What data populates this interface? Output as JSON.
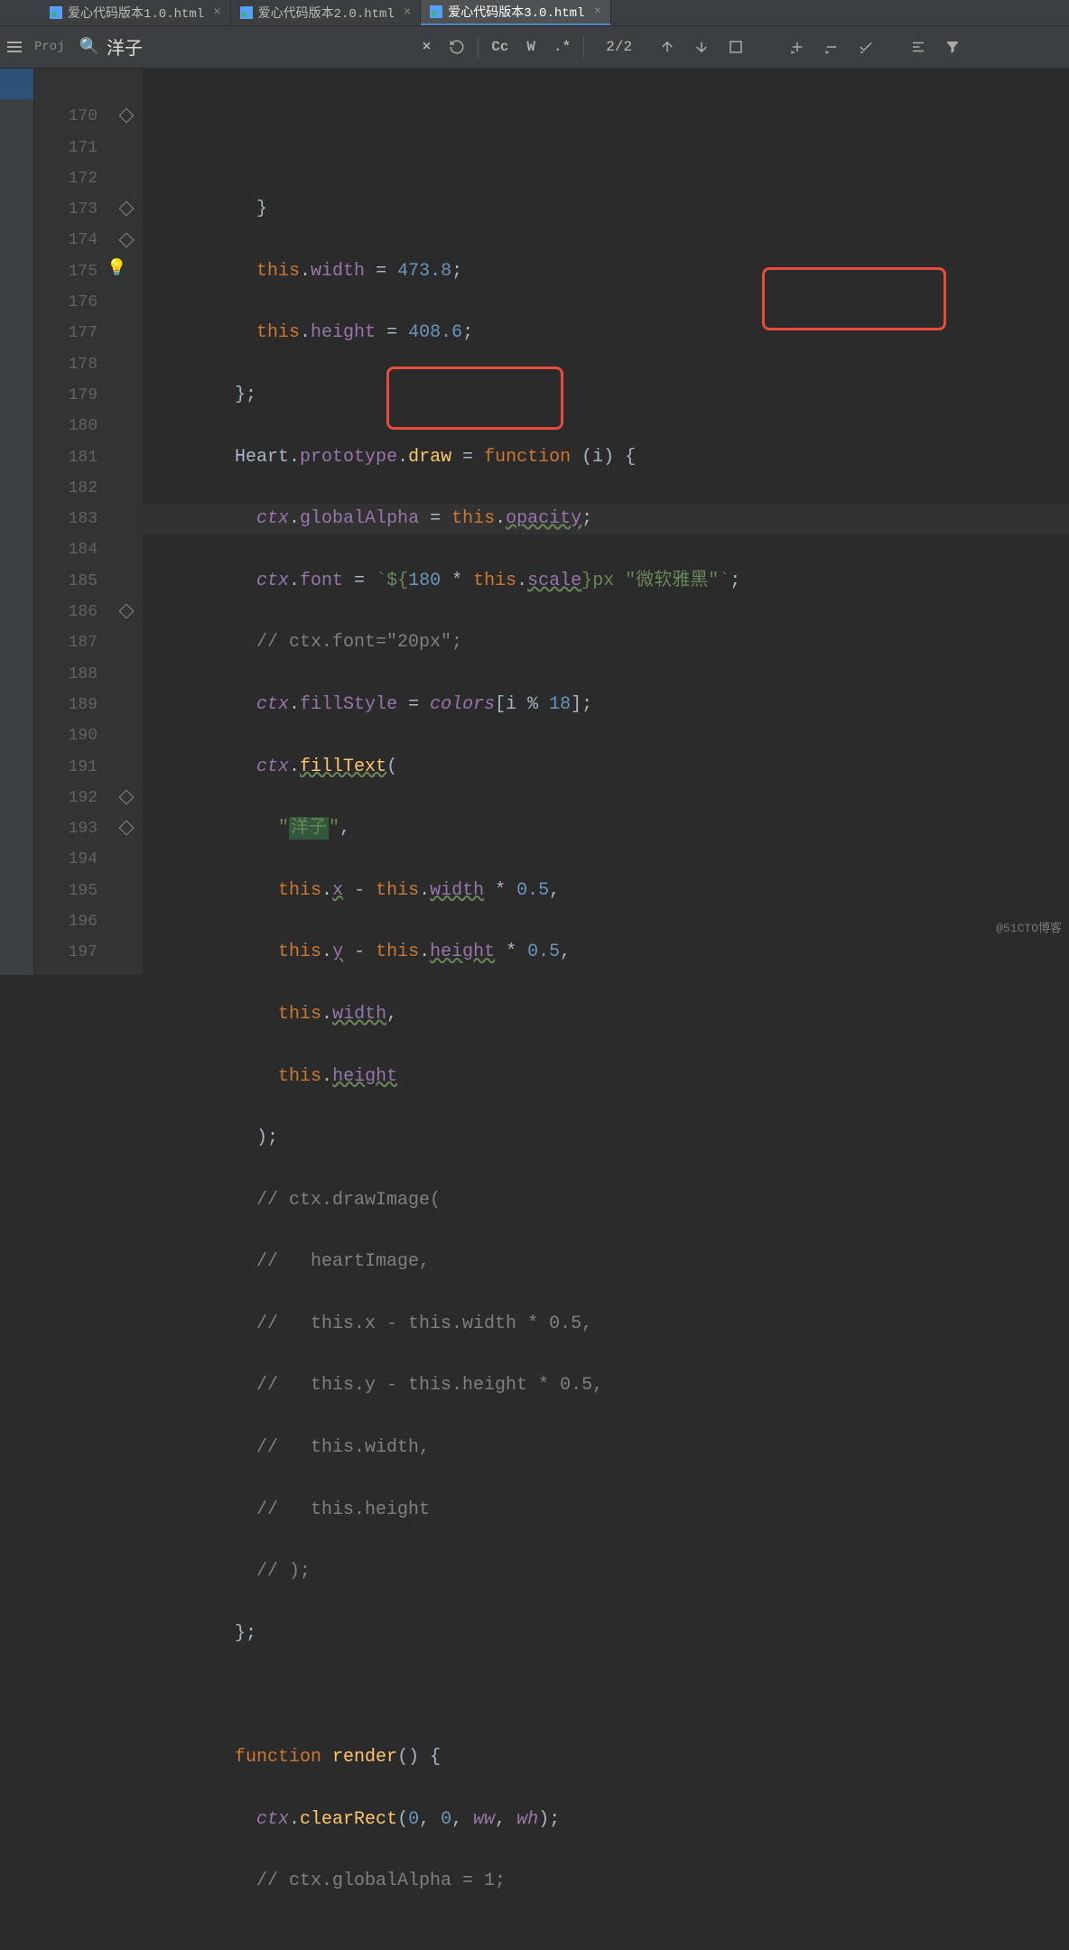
{
  "tabs": [
    {
      "label": "爱心代码版本1.0.html",
      "active": false
    },
    {
      "label": "爱心代码版本2.0.html",
      "active": false
    },
    {
      "label": "爱心代码版本3.0.html",
      "active": true
    }
  ],
  "project_label": "Proj",
  "search": {
    "query": "洋子",
    "close": "×",
    "counter": "2/2"
  },
  "toolbar": {
    "cc": "Cc",
    "w": "W",
    "dotstar": ".*"
  },
  "line_numbers": [
    "",
    "170",
    "171",
    "172",
    "173",
    "174",
    "175",
    "176",
    "177",
    "178",
    "179",
    "180",
    "181",
    "182",
    "183",
    "184",
    "185",
    "186",
    "187",
    "188",
    "189",
    "190",
    "191",
    "192",
    "193",
    "194",
    "195",
    "196",
    "197"
  ],
  "fold_positions": [
    1,
    4,
    5,
    17,
    23,
    24
  ],
  "code": {
    "l170": "        }",
    "l171_a": "        ",
    "l171_this": "this",
    "l171_b": ".",
    "l171_width": "width",
    "l171_c": " = ",
    "l171_num": "473.8",
    "l171_d": ";",
    "l172_a": "        ",
    "l172_this": "this",
    "l172_b": ".",
    "l172_height": "height",
    "l172_c": " = ",
    "l172_num": "408.6",
    "l172_d": ";",
    "l173": "      };",
    "l174_a": "      ",
    "l174_heart": "Heart",
    "l174_b": ".",
    "l174_proto": "prototype",
    "l174_c": ".",
    "l174_draw": "draw",
    "l174_d": " = ",
    "l174_fn": "function",
    "l174_e": " (",
    "l174_i": "i",
    "l174_f": ") {",
    "l175_a": "        ",
    "l175_ctx": "ctx",
    "l175_b": ".",
    "l175_ga": "globalAlpha",
    "l175_c": " = ",
    "l175_this": "this",
    "l175_d": ".",
    "l175_op": "opacity",
    "l175_e": ";",
    "l176_a": "        ",
    "l176_ctx": "ctx",
    "l176_b": ".",
    "l176_font": "font",
    "l176_c": " = ",
    "l176_s1": "`${",
    "l176_n": "180",
    "l176_s2": " * ",
    "l176_this": "this",
    "l176_d": ".",
    "l176_scale": "scale",
    "l176_s3": "}",
    "l176_s4": "px \"微软雅黑\"`",
    "l176_e": ";",
    "l177": "        // ctx.font=\"20px\";",
    "l178_a": "        ",
    "l178_ctx": "ctx",
    "l178_b": ".",
    "l178_fs": "fillStyle",
    "l178_c": " = ",
    "l178_colors": "colors",
    "l178_d": "[",
    "l178_i": "i",
    "l178_e": " % ",
    "l178_n": "18",
    "l178_f": "];",
    "l179_a": "        ",
    "l179_ctx": "ctx",
    "l179_b": ".",
    "l179_ft": "fillText",
    "l179_c": "(",
    "l180_a": "          ",
    "l180_q": "\"",
    "l180_txt": "洋子",
    "l180_q2": "\"",
    "l180_c": ",",
    "l181_a": "          ",
    "l181_this": "this",
    "l181_b": ".",
    "l181_x": "x",
    "l181_c": " - ",
    "l181_this2": "this",
    "l181_d": ".",
    "l181_w": "width",
    "l181_e": " * ",
    "l181_n": "0.5",
    "l181_f": ",",
    "l182_a": "          ",
    "l182_this": "this",
    "l182_b": ".",
    "l182_y": "y",
    "l182_c": " - ",
    "l182_this2": "this",
    "l182_d": ".",
    "l182_h": "height",
    "l182_e": " * ",
    "l182_n": "0.5",
    "l182_f": ",",
    "l183_a": "          ",
    "l183_this": "this",
    "l183_b": ".",
    "l183_w": "width",
    "l183_c": ",",
    "l184_a": "          ",
    "l184_this": "this",
    "l184_b": ".",
    "l184_h": "height",
    "l185": "        );",
    "l186": "        // ctx.drawImage(",
    "l187": "        //   heartImage,",
    "l188": "        //   this.x - this.width * 0.5,",
    "l189": "        //   this.y - this.height * 0.5,",
    "l190": "        //   this.width,",
    "l191": "        //   this.height",
    "l192": "        // );",
    "l193": "      };",
    "l194": "",
    "l195_a": "      ",
    "l195_fn": "function",
    "l195_b": " ",
    "l195_name": "render",
    "l195_c": "() {",
    "l196_a": "        ",
    "l196_ctx": "ctx",
    "l196_b": ".",
    "l196_cr": "clearRect",
    "l196_c": "(",
    "l196_z1": "0",
    "l196_d": ", ",
    "l196_z2": "0",
    "l196_e": ", ",
    "l196_ww": "ww",
    "l196_f": ", ",
    "l196_wh": "wh",
    "l196_g": ");",
    "l197": "        // ctx.globalAlpha = 1;"
  },
  "watermark": "@51CTO博客"
}
